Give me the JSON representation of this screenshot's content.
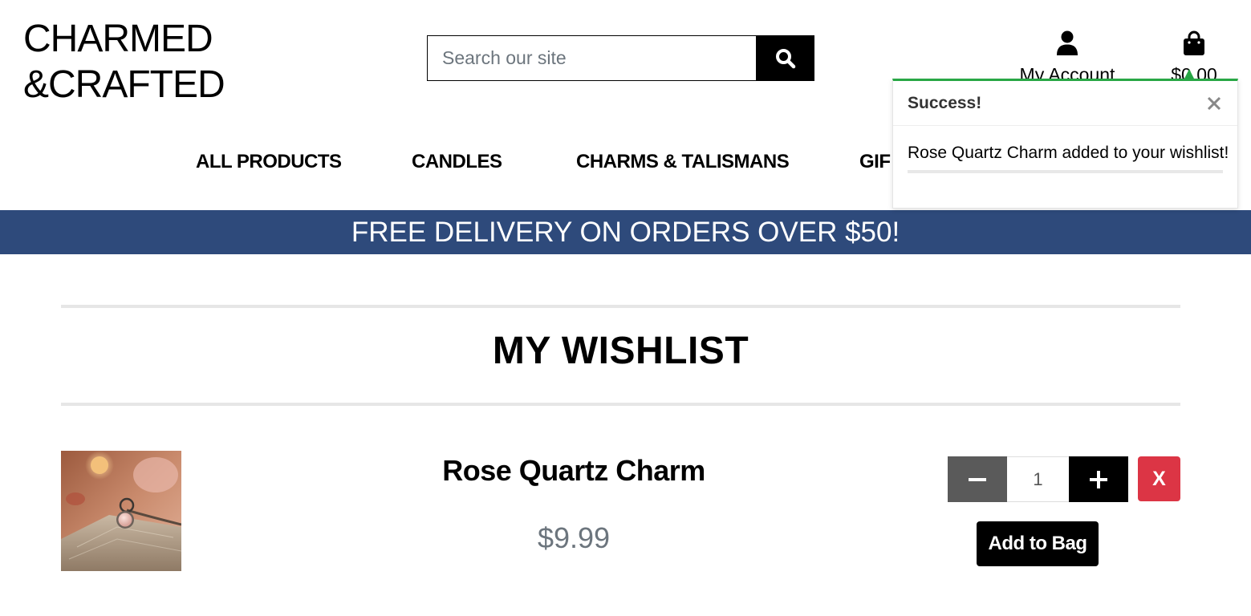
{
  "brand": {
    "line1": "CHARMED",
    "line2": "&CRAFTED"
  },
  "search": {
    "placeholder": "Search our site"
  },
  "header": {
    "account_label": "My Account",
    "bag_total": "$0.00"
  },
  "nav": {
    "items": [
      {
        "label": "ALL PRODUCTS"
      },
      {
        "label": "CANDLES"
      },
      {
        "label": "CHARMS & TALISMANS"
      },
      {
        "label": "GIF"
      }
    ]
  },
  "banner": {
    "text": "FREE DELIVERY ON ORDERS OVER $50!"
  },
  "page": {
    "title": "MY WISHLIST"
  },
  "wishlist": {
    "items": [
      {
        "name": "Rose Quartz Charm",
        "price": "$9.99",
        "quantity": "1",
        "remove_label": "X",
        "add_label": "Add to Bag"
      }
    ]
  },
  "toast": {
    "title": "Success!",
    "message": "Rose Quartz Charm added to your wishlist!"
  },
  "colors": {
    "banner": "#2e4a7b",
    "success": "#28a745",
    "remove": "#dc3545",
    "minus": "#5a5a5a",
    "price": "#6c757d"
  },
  "icons": {
    "search": "search-icon",
    "account": "user-icon",
    "bag": "shopping-bag-icon",
    "minus": "minus-icon",
    "plus": "plus-icon",
    "close": "close-icon"
  }
}
